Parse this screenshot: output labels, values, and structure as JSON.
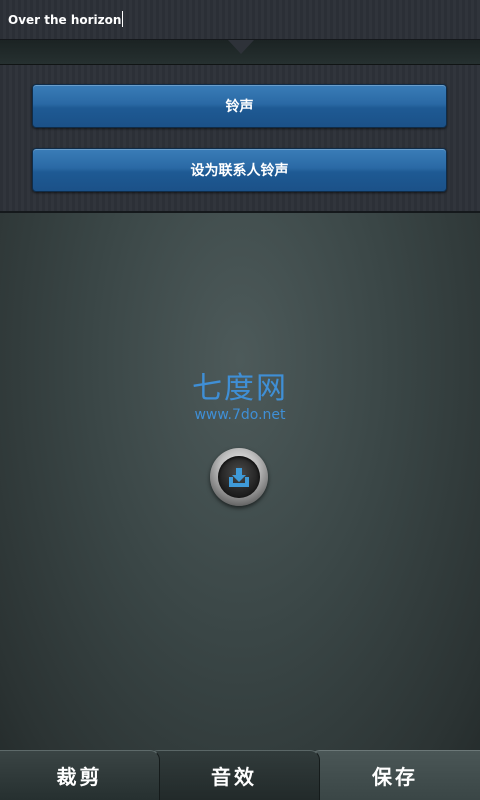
{
  "title_bar": {
    "title": "Over the horizon"
  },
  "options": {
    "ringtone_label": "铃声",
    "contact_ringtone_label": "设为联系人铃声"
  },
  "watermark": {
    "name": "七度网",
    "url": "www.7do.net"
  },
  "save_button": {
    "icon": "download-tray-icon"
  },
  "tabs": {
    "cut": "裁剪",
    "effect": "音效",
    "save": "保存"
  },
  "colors": {
    "accent_blue": "#2a69a5",
    "watermark_blue": "#3f8fd6"
  }
}
